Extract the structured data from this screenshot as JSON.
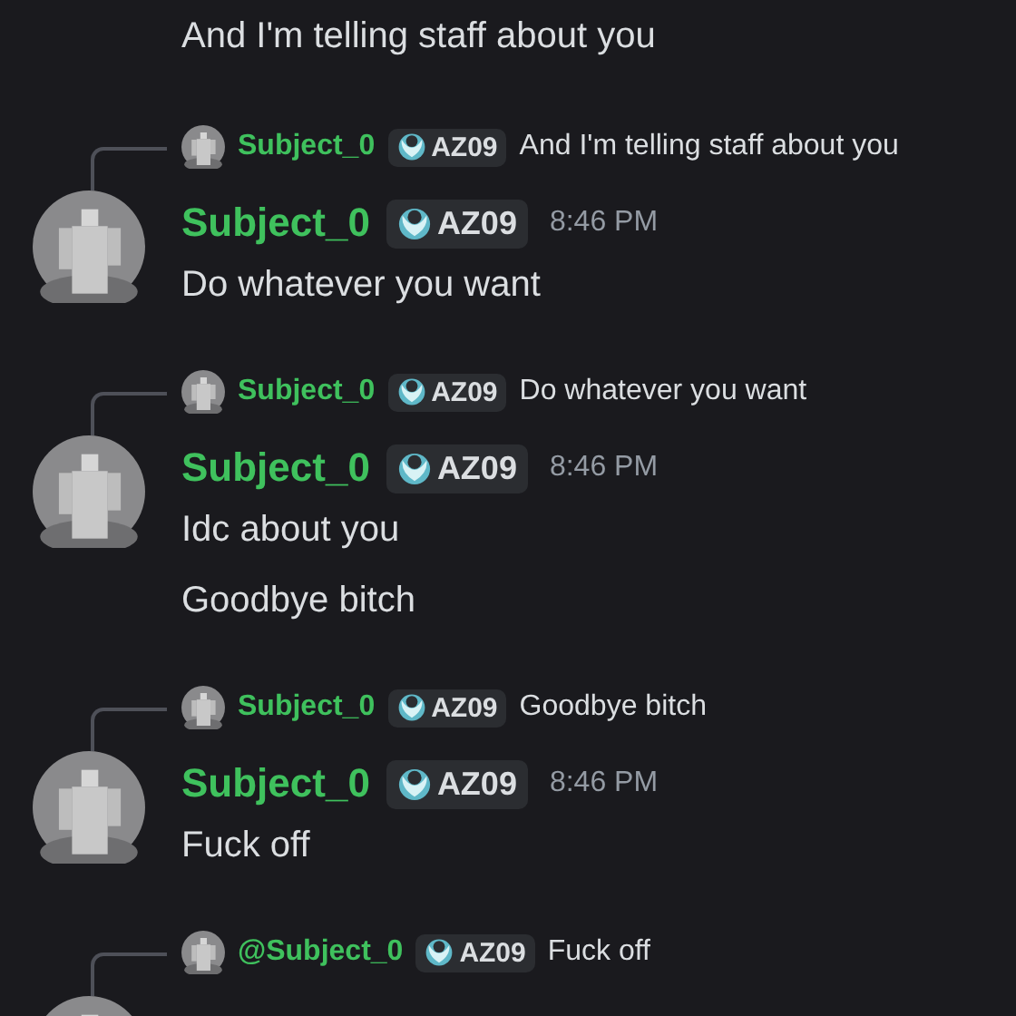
{
  "top_message": "And I'm telling staff about you",
  "messages": [
    {
      "reply": {
        "name": "Subject_0",
        "tag": "AZ09",
        "text": "And I'm telling staff about you"
      },
      "author": "Subject_0",
      "tag": "AZ09",
      "time": "8:46 PM",
      "lines": [
        "Do whatever you want"
      ]
    },
    {
      "reply": {
        "name": "Subject_0",
        "tag": "AZ09",
        "text": "Do whatever you want"
      },
      "author": "Subject_0",
      "tag": "AZ09",
      "time": "8:46 PM",
      "lines": [
        "Idc about you",
        "Goodbye bitch"
      ]
    },
    {
      "reply": {
        "name": "Subject_0",
        "tag": "AZ09",
        "text": "Goodbye bitch"
      },
      "author": "Subject_0",
      "tag": "AZ09",
      "time": "8:46 PM",
      "lines": [
        "Fuck off"
      ]
    },
    {
      "reply": {
        "name": "@Subject_0",
        "tag": "AZ09",
        "text": "Fuck off"
      }
    }
  ]
}
